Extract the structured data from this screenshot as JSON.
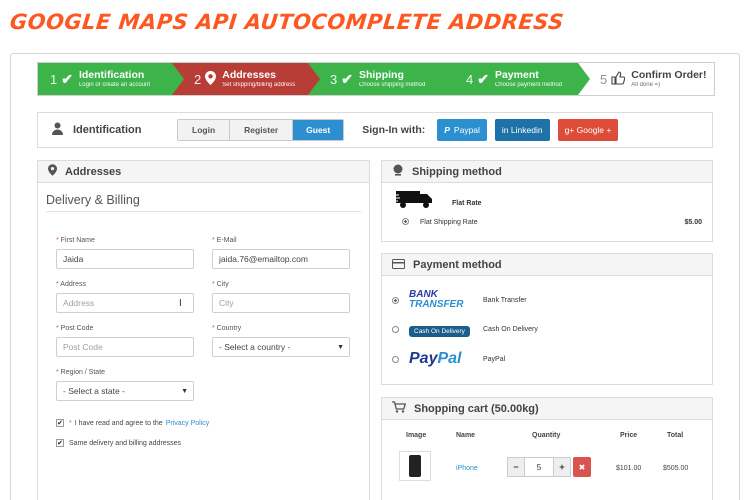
{
  "banner": "Google Maps API Autocomplete Address",
  "steps": [
    {
      "num": "1",
      "icon": "✔",
      "title": "Identification",
      "sub": "Login or create an account",
      "color": "green"
    },
    {
      "num": "2",
      "icon": "⬤",
      "title": "Addresses",
      "sub": "Set shipping/billing address",
      "color": "red"
    },
    {
      "num": "3",
      "icon": "✔",
      "title": "Shipping",
      "sub": "Choose shipping method",
      "color": "green"
    },
    {
      "num": "4",
      "icon": "✔",
      "title": "Payment",
      "sub": "Choose payment method",
      "color": "green"
    },
    {
      "num": "5",
      "icon": "👍",
      "title": "Confirm Order!",
      "sub": "All done =)",
      "color": "white"
    }
  ],
  "identification": {
    "label": "Identification",
    "tabs": [
      "Login",
      "Register",
      "Guest"
    ],
    "signin_label": "Sign-In with:",
    "paypal": "Paypal",
    "linkedin": "in Linkedin",
    "google": "g+ Google +"
  },
  "addresses": {
    "title": "Addresses",
    "subtitle": "Delivery & Billing",
    "first_name_label": "First Name",
    "first_name_value": "Jaida",
    "email_label": "E-Mail",
    "email_value": "jaida.76@emailtop.com",
    "address_label": "Address",
    "address_placeholder": "Address",
    "city_label": "City",
    "city_placeholder": "City",
    "postcode_label": "Post Code",
    "postcode_placeholder": "Post Code",
    "country_label": "Country",
    "country_value": "- Select a country -",
    "region_label": "Region / State",
    "region_value": "- Select a state -",
    "agree_text": "I have read and agree to the",
    "privacy_link": "Privacy Policy",
    "same_address": "Same delivery and billing addresses"
  },
  "shipping": {
    "title": "Shipping method",
    "rate_title": "Flat Rate",
    "option": "Flat Shipping Rate",
    "price": "$5.00"
  },
  "payment": {
    "title": "Payment method",
    "bank_logo_1": "BANK",
    "bank_logo_2": "TRANSFER",
    "bank": "Bank Transfer",
    "cod_logo": "Cash On Delivery",
    "cod": "Cash On Delivery",
    "paypal_logo_1": "Pay",
    "paypal_logo_2": "Pal",
    "paypal": "PayPal"
  },
  "cart": {
    "title": "Shopping cart (50.00kg)",
    "headers": [
      "Image",
      "Name",
      "Quantity",
      "Price",
      "Total"
    ],
    "item_name": "iPhone",
    "qty": "5",
    "price": "$101.00",
    "total": "$505.00"
  },
  "colors": {
    "accent": "#ff5722",
    "green": "#3cb44a",
    "red": "#b83d37",
    "blue": "#2c8fd0"
  }
}
